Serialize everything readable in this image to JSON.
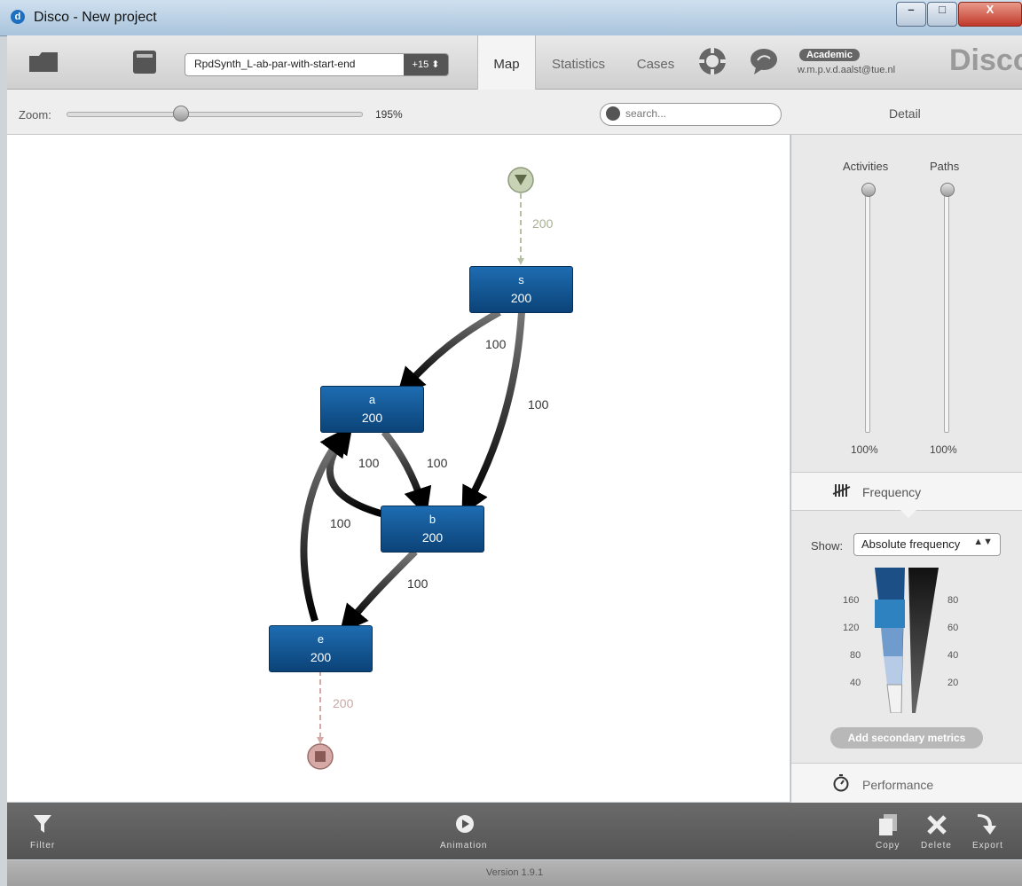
{
  "window": {
    "title": "Disco - New project",
    "minimize": "–",
    "maximize": "□",
    "close": "X"
  },
  "toolbar": {
    "dataset_name": "RpdSynth_L-ab-par-with-start-end",
    "dataset_count": "+15 ⬍",
    "tabs": [
      {
        "label": "Map"
      },
      {
        "label": "Statistics"
      },
      {
        "label": "Cases"
      }
    ],
    "badge": "Academic",
    "user_email": "w.m.p.v.d.aalst@tue.nl",
    "brand": "Disco"
  },
  "zoom": {
    "label": "Zoom:",
    "value": "195%"
  },
  "search": {
    "placeholder": "search..."
  },
  "detail_panel": {
    "title": "Detail",
    "activities_label": "Activities",
    "paths_label": "Paths",
    "activities_value": "100%",
    "paths_value": "100%",
    "frequency_label": "Frequency",
    "show_label": "Show:",
    "show_value": "Absolute frequency",
    "left_scale": [
      "160",
      "120",
      "80",
      "40"
    ],
    "right_scale": [
      "80",
      "60",
      "40",
      "20"
    ],
    "add_secondary": "Add secondary metrics",
    "performance_label": "Performance"
  },
  "process_map": {
    "nodes": [
      {
        "id": "s",
        "name": "s",
        "freq": "200"
      },
      {
        "id": "a",
        "name": "a",
        "freq": "200"
      },
      {
        "id": "b",
        "name": "b",
        "freq": "200"
      },
      {
        "id": "e",
        "name": "e",
        "freq": "200"
      }
    ],
    "edges": [
      {
        "from": "start",
        "to": "s",
        "label": "200"
      },
      {
        "from": "s",
        "to": "a",
        "label": "100"
      },
      {
        "from": "s",
        "to": "b",
        "label": "100"
      },
      {
        "from": "a",
        "to": "b",
        "label": "100"
      },
      {
        "from": "b",
        "to": "a",
        "label": "100"
      },
      {
        "from": "e",
        "to": "a",
        "label": "100"
      },
      {
        "from": "b",
        "to": "e",
        "label": "100"
      },
      {
        "from": "e",
        "to": "end",
        "label": "200"
      }
    ]
  },
  "bottom": {
    "filter": "Filter",
    "animation": "Animation",
    "copy": "Copy",
    "delete": "Delete",
    "export": "Export"
  },
  "version": "Version 1.9.1",
  "colors": {
    "node": "#0b4a86",
    "accent": "#1f6fc0",
    "start": "#c8d2b4",
    "end": "#d7a9a6"
  }
}
